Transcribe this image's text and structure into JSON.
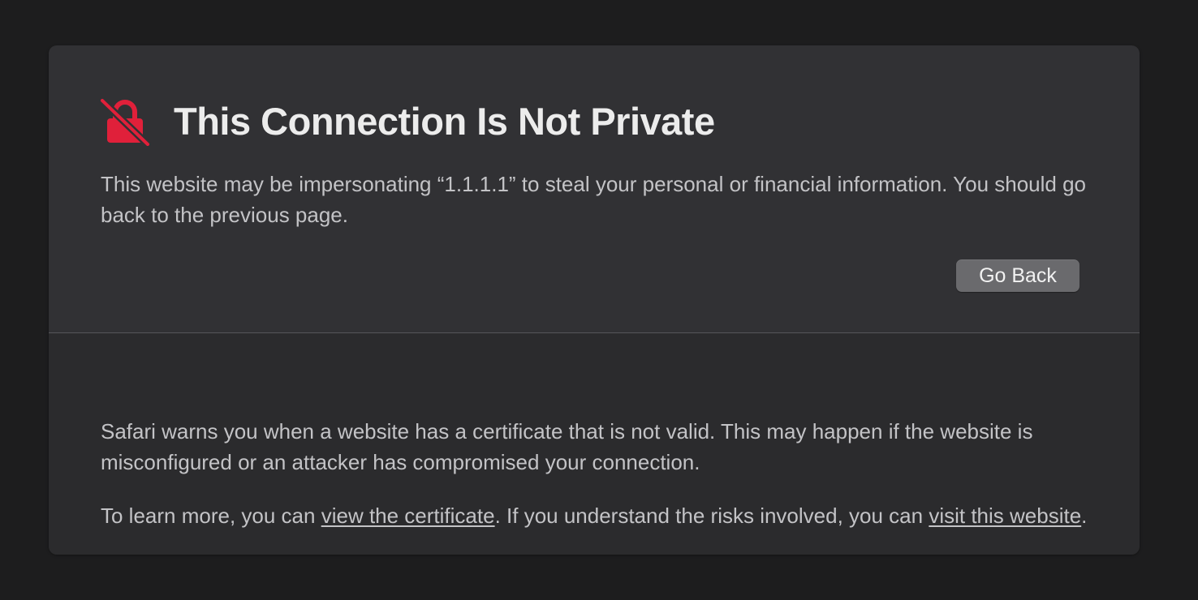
{
  "colors": {
    "page_background": "#1d1d1e",
    "card_top": "#313134",
    "card_bottom": "#2b2b2d",
    "warning_red": "#e0203a",
    "button_background": "#6a6a6d"
  },
  "header": {
    "icon": "lock-broken-icon",
    "title": "This Connection Is Not Private"
  },
  "warning": {
    "text": "This website may be impersonating “1.1.1.1” to steal your personal or financial information. You should go back to the previous page."
  },
  "actions": {
    "go_back_label": "Go Back"
  },
  "details": {
    "paragraph_1": "Safari warns you when a website has a certificate that is not valid. This may happen if the website is misconfigured or an attacker has compromised your connection.",
    "paragraph_2_prefix": "To learn more, you can ",
    "view_certificate_link": "view the certificate",
    "paragraph_2_middle": ". If you understand the risks involved, you can ",
    "visit_website_link": "visit this website",
    "paragraph_2_suffix": "."
  }
}
